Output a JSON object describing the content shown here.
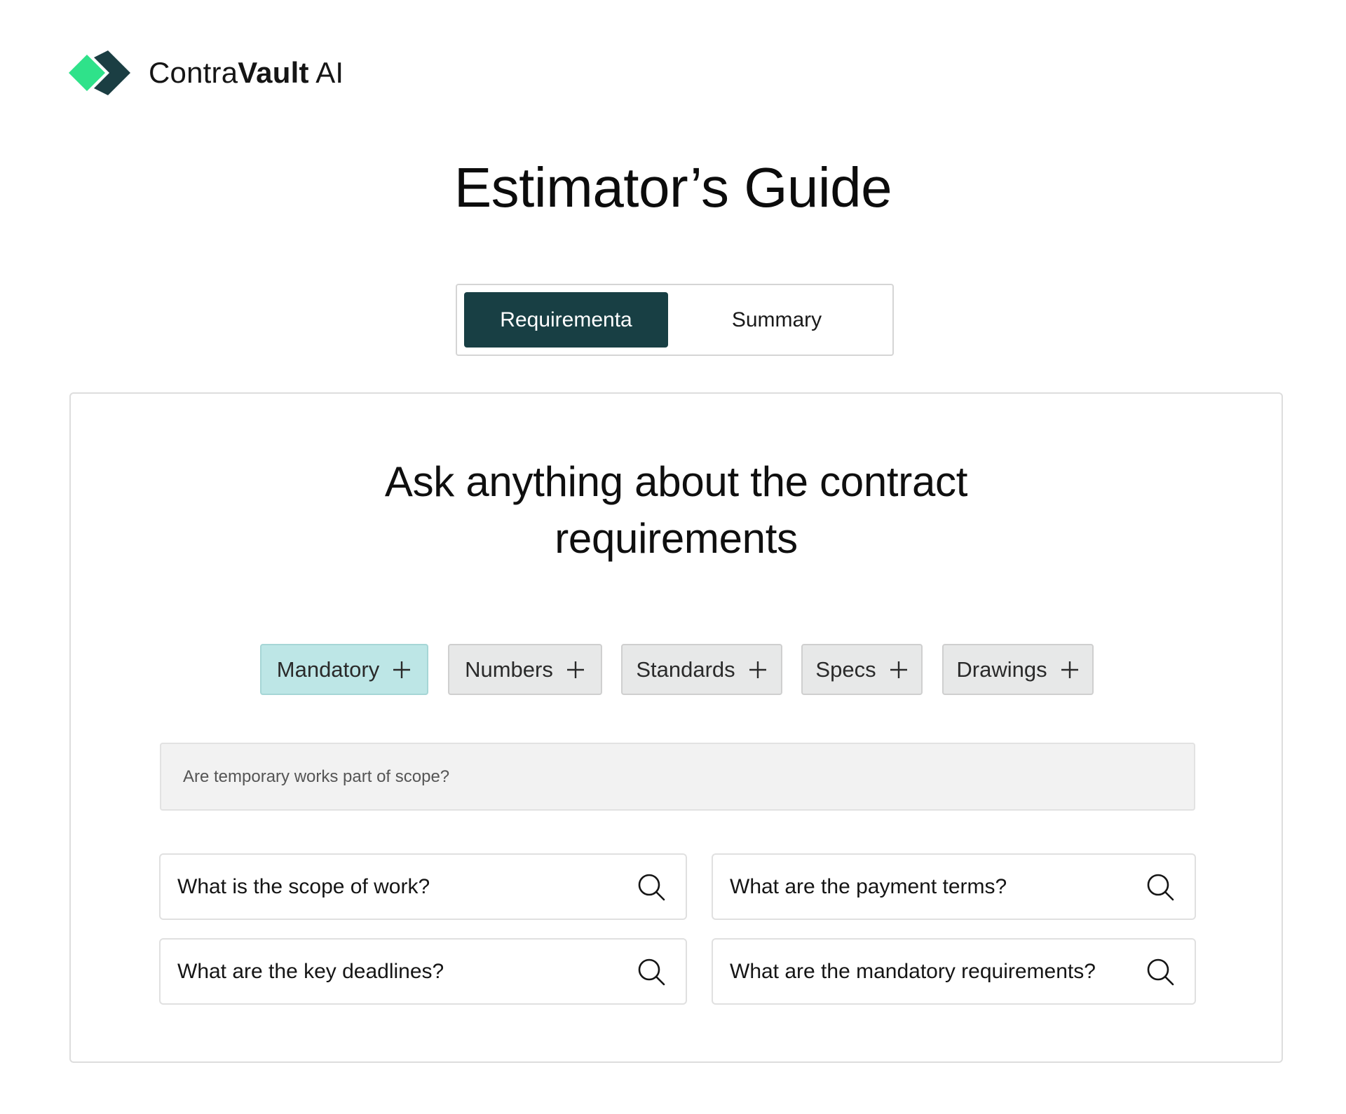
{
  "brand": {
    "name_regular": "Contra",
    "name_bold": "Vault",
    "name_suffix": " AI",
    "colors": {
      "light": "#2fe28a",
      "dark": "#1b3e43"
    }
  },
  "page_title": "Estimator’s Guide",
  "tabs": [
    {
      "label": "Requirementa",
      "active": true
    },
    {
      "label": "Summary",
      "active": false
    }
  ],
  "main": {
    "heading_line1": "Ask anything about the contract",
    "heading_line2": "requirements",
    "filters": [
      {
        "label": "Mandatory",
        "icon": "plus-icon",
        "active": true
      },
      {
        "label": "Numbers",
        "icon": "plus-icon",
        "active": false
      },
      {
        "label": "Standards",
        "icon": "plus-icon",
        "active": false
      },
      {
        "label": "Specs",
        "icon": "plus-icon",
        "active": false
      },
      {
        "label": "Drawings",
        "icon": "plus-icon",
        "active": false
      }
    ],
    "search": {
      "placeholder": "Are temporary works part of scope?",
      "value": ""
    },
    "suggestions": [
      {
        "label": "What is the scope of work?",
        "icon": "search-icon"
      },
      {
        "label": "What are the payment terms?",
        "icon": "search-icon"
      },
      {
        "label": "What are the key deadlines?",
        "icon": "search-icon"
      },
      {
        "label": "What are the mandatory requirements?",
        "icon": "search-icon"
      }
    ]
  },
  "colors": {
    "active_tab_bg": "#183f44",
    "active_chip_bg": "#bde6e6",
    "chip_bg": "#e7e8e8",
    "input_bg": "#f2f2f2"
  }
}
